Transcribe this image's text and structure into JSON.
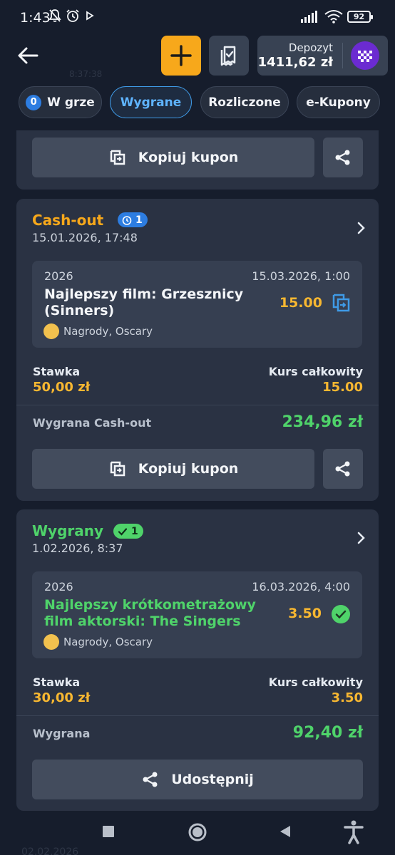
{
  "status_bar": {
    "time": "1:43",
    "battery": "92"
  },
  "header": {
    "deposit_label": "Depozyt",
    "deposit_value": "1411,62 zł",
    "ghost_text": "8:37:38"
  },
  "tabs": [
    {
      "label": "W grze",
      "count": "0"
    },
    {
      "label": "Wygrane"
    },
    {
      "label": "Rozliczone"
    },
    {
      "label": "e-Kupony"
    }
  ],
  "card0": {
    "copy_label": "Kopiuj kupon"
  },
  "card1": {
    "status": "Cash-out",
    "badge_count": "1",
    "date": "15.01.2026, 17:48",
    "selection": {
      "year": "2026",
      "event_date": "15.03.2026, 1:00",
      "name": "Najlepszy film: Grzesznicy (Sinners)",
      "odd": "15.00",
      "category": "Nagrody, Oscary"
    },
    "stake_label": "Stawka",
    "stake_value": "50,00 zł",
    "total_odds_label": "Kurs całkowity",
    "total_odds_value": "15.00",
    "win_label": "Wygrana Cash-out",
    "win_value": "234,96 zł",
    "copy_label": "Kopiuj kupon"
  },
  "card2": {
    "status": "Wygrany",
    "badge_count": "1",
    "date": "1.02.2026, 8:37",
    "selection": {
      "year": "2026",
      "event_date": "16.03.2026, 4:00",
      "name": "Najlepszy krótkometrażowy film aktorski: The Singers",
      "odd": "3.50",
      "category": "Nagrody, Oscary"
    },
    "stake_label": "Stawka",
    "stake_value": "30,00 zł",
    "total_odds_label": "Kurs całkowity",
    "total_odds_value": "3.50",
    "win_label": "Wygrana",
    "win_value": "92,40 zł",
    "share_label": "Udostępnij"
  },
  "footer": {
    "ghost_text": "02.02.2026"
  },
  "colors": {
    "background": "#161d2c",
    "card": "#2a3243",
    "accent_orange": "#f7a81b",
    "odds_yellow": "#f7b731",
    "win_green": "#4fd36a",
    "tab_active": "#5fb4ff"
  }
}
